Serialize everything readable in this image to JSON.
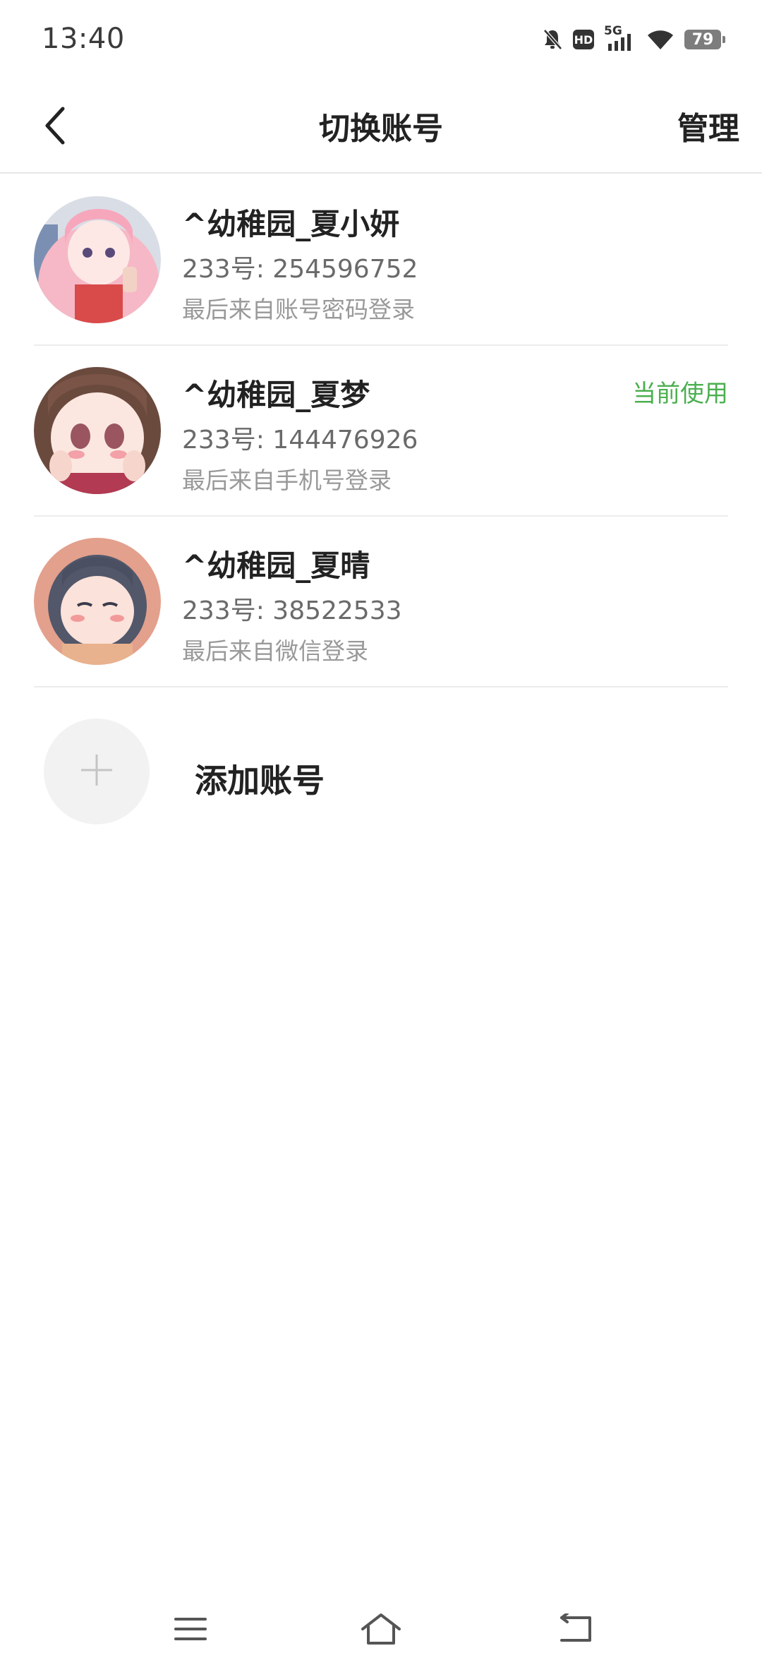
{
  "status_bar": {
    "time": "13:40",
    "hd_badge": "HD",
    "network": "5G",
    "battery": "79",
    "icons": [
      "mute-bell-icon",
      "hd-icon",
      "signal-5g-icon",
      "wifi-icon",
      "battery-icon"
    ]
  },
  "header": {
    "back_icon": "chevron-left-icon",
    "title": "切换账号",
    "manage_label": "管理"
  },
  "accounts": [
    {
      "name": "^幼稚园_夏小妍",
      "id_text": "233号: 254596752",
      "source": "最后来自账号密码登录",
      "current": false
    },
    {
      "name": "^幼稚园_夏梦",
      "id_text": "233号: 144476926",
      "source": "最后来自手机号登录",
      "current": true,
      "current_label": "当前使用"
    },
    {
      "name": "^幼稚园_夏晴",
      "id_text": "233号: 38522533",
      "source": "最后来自微信登录",
      "current": false
    }
  ],
  "add_account": {
    "icon": "plus-icon",
    "label": "添加账号"
  },
  "nav_bar": {
    "icons": [
      "menu-icon",
      "home-icon",
      "back-icon"
    ]
  },
  "colors": {
    "accent_green": "#4caf50",
    "divider": "#ececec",
    "secondary_text": "#999999"
  }
}
